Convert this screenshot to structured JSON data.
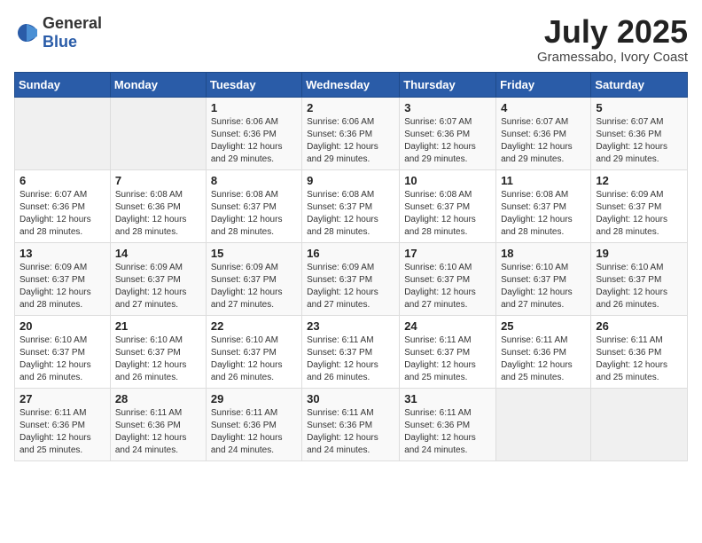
{
  "logo": {
    "general": "General",
    "blue": "Blue"
  },
  "title": {
    "month_year": "July 2025",
    "location": "Gramessabo, Ivory Coast"
  },
  "days_of_week": [
    "Sunday",
    "Monday",
    "Tuesday",
    "Wednesday",
    "Thursday",
    "Friday",
    "Saturday"
  ],
  "weeks": [
    [
      {
        "day": "",
        "sunrise": "",
        "sunset": "",
        "daylight": ""
      },
      {
        "day": "",
        "sunrise": "",
        "sunset": "",
        "daylight": ""
      },
      {
        "day": "1",
        "sunrise": "Sunrise: 6:06 AM",
        "sunset": "Sunset: 6:36 PM",
        "daylight": "Daylight: 12 hours and 29 minutes."
      },
      {
        "day": "2",
        "sunrise": "Sunrise: 6:06 AM",
        "sunset": "Sunset: 6:36 PM",
        "daylight": "Daylight: 12 hours and 29 minutes."
      },
      {
        "day": "3",
        "sunrise": "Sunrise: 6:07 AM",
        "sunset": "Sunset: 6:36 PM",
        "daylight": "Daylight: 12 hours and 29 minutes."
      },
      {
        "day": "4",
        "sunrise": "Sunrise: 6:07 AM",
        "sunset": "Sunset: 6:36 PM",
        "daylight": "Daylight: 12 hours and 29 minutes."
      },
      {
        "day": "5",
        "sunrise": "Sunrise: 6:07 AM",
        "sunset": "Sunset: 6:36 PM",
        "daylight": "Daylight: 12 hours and 29 minutes."
      }
    ],
    [
      {
        "day": "6",
        "sunrise": "Sunrise: 6:07 AM",
        "sunset": "Sunset: 6:36 PM",
        "daylight": "Daylight: 12 hours and 28 minutes."
      },
      {
        "day": "7",
        "sunrise": "Sunrise: 6:08 AM",
        "sunset": "Sunset: 6:36 PM",
        "daylight": "Daylight: 12 hours and 28 minutes."
      },
      {
        "day": "8",
        "sunrise": "Sunrise: 6:08 AM",
        "sunset": "Sunset: 6:37 PM",
        "daylight": "Daylight: 12 hours and 28 minutes."
      },
      {
        "day": "9",
        "sunrise": "Sunrise: 6:08 AM",
        "sunset": "Sunset: 6:37 PM",
        "daylight": "Daylight: 12 hours and 28 minutes."
      },
      {
        "day": "10",
        "sunrise": "Sunrise: 6:08 AM",
        "sunset": "Sunset: 6:37 PM",
        "daylight": "Daylight: 12 hours and 28 minutes."
      },
      {
        "day": "11",
        "sunrise": "Sunrise: 6:08 AM",
        "sunset": "Sunset: 6:37 PM",
        "daylight": "Daylight: 12 hours and 28 minutes."
      },
      {
        "day": "12",
        "sunrise": "Sunrise: 6:09 AM",
        "sunset": "Sunset: 6:37 PM",
        "daylight": "Daylight: 12 hours and 28 minutes."
      }
    ],
    [
      {
        "day": "13",
        "sunrise": "Sunrise: 6:09 AM",
        "sunset": "Sunset: 6:37 PM",
        "daylight": "Daylight: 12 hours and 28 minutes."
      },
      {
        "day": "14",
        "sunrise": "Sunrise: 6:09 AM",
        "sunset": "Sunset: 6:37 PM",
        "daylight": "Daylight: 12 hours and 27 minutes."
      },
      {
        "day": "15",
        "sunrise": "Sunrise: 6:09 AM",
        "sunset": "Sunset: 6:37 PM",
        "daylight": "Daylight: 12 hours and 27 minutes."
      },
      {
        "day": "16",
        "sunrise": "Sunrise: 6:09 AM",
        "sunset": "Sunset: 6:37 PM",
        "daylight": "Daylight: 12 hours and 27 minutes."
      },
      {
        "day": "17",
        "sunrise": "Sunrise: 6:10 AM",
        "sunset": "Sunset: 6:37 PM",
        "daylight": "Daylight: 12 hours and 27 minutes."
      },
      {
        "day": "18",
        "sunrise": "Sunrise: 6:10 AM",
        "sunset": "Sunset: 6:37 PM",
        "daylight": "Daylight: 12 hours and 27 minutes."
      },
      {
        "day": "19",
        "sunrise": "Sunrise: 6:10 AM",
        "sunset": "Sunset: 6:37 PM",
        "daylight": "Daylight: 12 hours and 26 minutes."
      }
    ],
    [
      {
        "day": "20",
        "sunrise": "Sunrise: 6:10 AM",
        "sunset": "Sunset: 6:37 PM",
        "daylight": "Daylight: 12 hours and 26 minutes."
      },
      {
        "day": "21",
        "sunrise": "Sunrise: 6:10 AM",
        "sunset": "Sunset: 6:37 PM",
        "daylight": "Daylight: 12 hours and 26 minutes."
      },
      {
        "day": "22",
        "sunrise": "Sunrise: 6:10 AM",
        "sunset": "Sunset: 6:37 PM",
        "daylight": "Daylight: 12 hours and 26 minutes."
      },
      {
        "day": "23",
        "sunrise": "Sunrise: 6:11 AM",
        "sunset": "Sunset: 6:37 PM",
        "daylight": "Daylight: 12 hours and 26 minutes."
      },
      {
        "day": "24",
        "sunrise": "Sunrise: 6:11 AM",
        "sunset": "Sunset: 6:37 PM",
        "daylight": "Daylight: 12 hours and 25 minutes."
      },
      {
        "day": "25",
        "sunrise": "Sunrise: 6:11 AM",
        "sunset": "Sunset: 6:36 PM",
        "daylight": "Daylight: 12 hours and 25 minutes."
      },
      {
        "day": "26",
        "sunrise": "Sunrise: 6:11 AM",
        "sunset": "Sunset: 6:36 PM",
        "daylight": "Daylight: 12 hours and 25 minutes."
      }
    ],
    [
      {
        "day": "27",
        "sunrise": "Sunrise: 6:11 AM",
        "sunset": "Sunset: 6:36 PM",
        "daylight": "Daylight: 12 hours and 25 minutes."
      },
      {
        "day": "28",
        "sunrise": "Sunrise: 6:11 AM",
        "sunset": "Sunset: 6:36 PM",
        "daylight": "Daylight: 12 hours and 24 minutes."
      },
      {
        "day": "29",
        "sunrise": "Sunrise: 6:11 AM",
        "sunset": "Sunset: 6:36 PM",
        "daylight": "Daylight: 12 hours and 24 minutes."
      },
      {
        "day": "30",
        "sunrise": "Sunrise: 6:11 AM",
        "sunset": "Sunset: 6:36 PM",
        "daylight": "Daylight: 12 hours and 24 minutes."
      },
      {
        "day": "31",
        "sunrise": "Sunrise: 6:11 AM",
        "sunset": "Sunset: 6:36 PM",
        "daylight": "Daylight: 12 hours and 24 minutes."
      },
      {
        "day": "",
        "sunrise": "",
        "sunset": "",
        "daylight": ""
      },
      {
        "day": "",
        "sunrise": "",
        "sunset": "",
        "daylight": ""
      }
    ]
  ]
}
